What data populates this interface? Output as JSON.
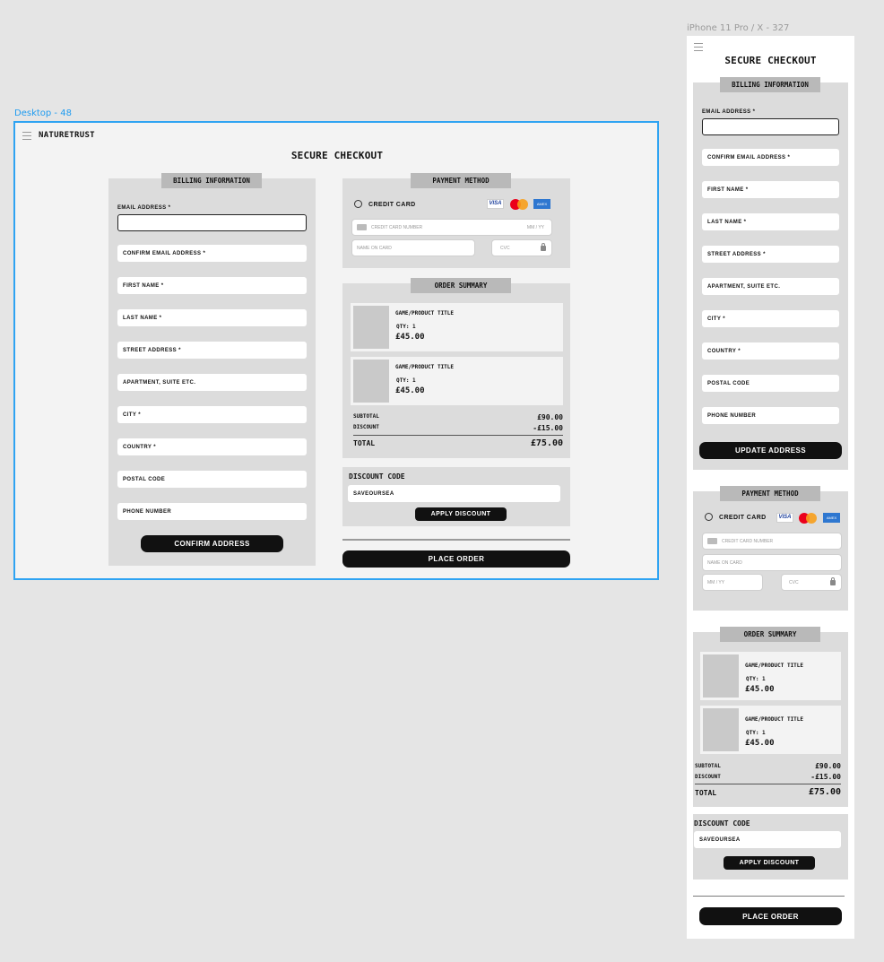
{
  "frames": {
    "desktop_label": "Desktop - 48",
    "mobile_label": "iPhone 11 Pro / X - 327"
  },
  "header": {
    "brand": "NATURETRUST",
    "title": "SECURE CHECKOUT"
  },
  "billing": {
    "tab": "BILLING INFORMATION",
    "email_label": "EMAIL ADDRESS *",
    "fields": [
      "CONFIRM EMAIL ADDRESS *",
      "FIRST NAME *",
      "LAST NAME *",
      "STREET ADDRESS *",
      "APARTMENT, SUITE ETC.",
      "CITY *",
      "COUNTRY *",
      "POSTAL CODE",
      "PHONE NUMBER"
    ],
    "confirm_button": "CONFIRM ADDRESS",
    "update_button": "UPDATE ADDRESS"
  },
  "payment": {
    "tab": "PAYMENT METHOD",
    "option": "CREDIT CARD",
    "cards": [
      "visa-card-icon",
      "mastercard-icon",
      "amex-card-icon"
    ],
    "visa_text": "VISA",
    "amex_text": "AMEX",
    "card_number_placeholder": "CREDIT CARD NUMBER",
    "expiry_placeholder": "MM / YY",
    "name_placeholder": "NAME ON CARD",
    "cvc_placeholder": "CVC"
  },
  "order": {
    "tab": "ORDER SUMMARY",
    "items": [
      {
        "title": "GAME/PRODUCT TITLE",
        "qty": "QTY: 1",
        "price": "£45.00"
      },
      {
        "title": "GAME/PRODUCT TITLE",
        "qty": "QTY: 1",
        "price": "£45.00"
      }
    ],
    "subtotal_label": "SUBTOTAL",
    "subtotal_value": "£90.00",
    "discount_label": "DISCOUNT",
    "discount_value": "-£15.00",
    "total_label": "TOTAL",
    "total_value": "£75.00"
  },
  "discount": {
    "label": "DISCOUNT CODE",
    "code": "SAVEOURSEA",
    "apply_button": "APPLY DISCOUNT"
  },
  "place_order_button": "PLACE ORDER",
  "colors": {
    "canvas": "#e5e5e5",
    "frame_selection": "#2ea3f2",
    "panel": "#dcdcdc",
    "tab": "#b9b9b9",
    "button": "#111111"
  }
}
